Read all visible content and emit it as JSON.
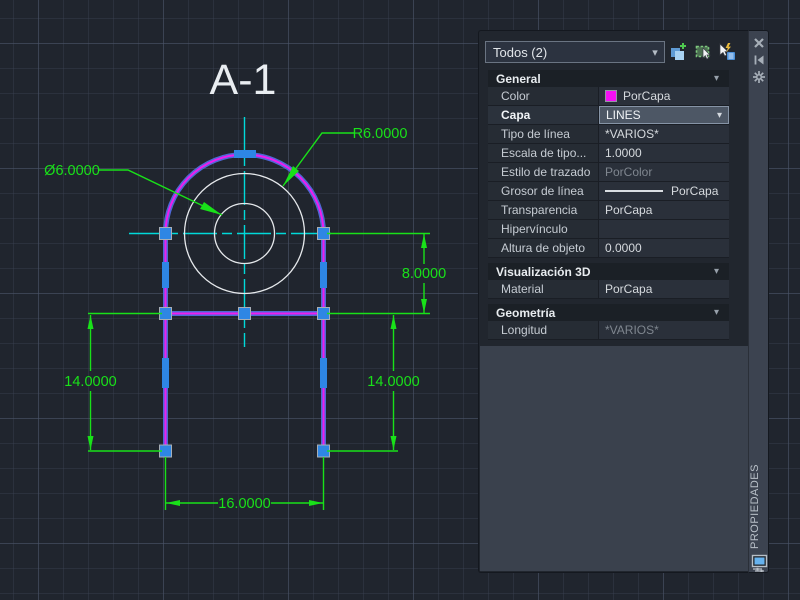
{
  "drawing": {
    "title": "A-1",
    "dims": {
      "height_upper": "8.0000",
      "height_left": "14.0000",
      "height_right": "14.0000",
      "width_bottom": "16.0000",
      "radius": "R6.0000",
      "diameter": "Ø6.0000"
    },
    "colors": {
      "geometry_magenta": "#ee1dee",
      "selection_blue": "#4f68d7",
      "grip_blue": "#2e86e4",
      "dimension_green": "#19e119",
      "centerline_cyan": "#00d9d9",
      "circle_white": "#e6e9ec"
    }
  },
  "palette": {
    "title": "PROPIEDADES",
    "selector": {
      "value": "Todos (2)"
    },
    "toolbar_icons": [
      "quick-select-icon",
      "select-objects-icon",
      "toggle-pickadd-icon"
    ],
    "rail_icons": [
      "close-icon",
      "auto-hide-icon",
      "settings-icon",
      "display-options-icon"
    ],
    "sections": [
      {
        "title": "General",
        "rows": [
          {
            "label": "Color",
            "value": "PorCapa",
            "swatch": "#f40ef4"
          },
          {
            "label": "Capa",
            "value": "LINES",
            "type": "dropdown",
            "selected": true
          },
          {
            "label": "Tipo de línea",
            "value": "*VARIOS*"
          },
          {
            "label": "Escala de tipo...",
            "value": "1.0000"
          },
          {
            "label": "Estilo de trazado",
            "value": "PorColor",
            "muted": true
          },
          {
            "label": "Grosor de línea",
            "value": "PorCapa",
            "lineweight": true
          },
          {
            "label": "Transparencia",
            "value": "PorCapa"
          },
          {
            "label": "Hipervínculo",
            "value": ""
          },
          {
            "label": "Altura de objeto",
            "value": "0.0000"
          }
        ]
      },
      {
        "title": "Visualización 3D",
        "rows": [
          {
            "label": "Material",
            "value": "PorCapa"
          }
        ]
      },
      {
        "title": "Geometría",
        "rows": [
          {
            "label": "Longitud",
            "value": "*VARIOS*",
            "muted": true
          }
        ]
      }
    ]
  }
}
